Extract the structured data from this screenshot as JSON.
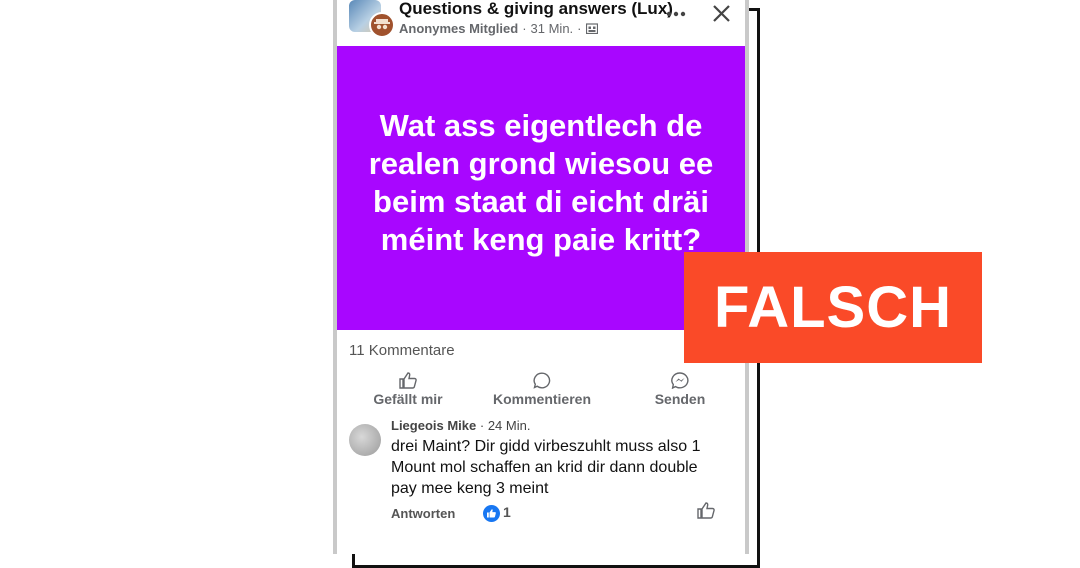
{
  "post": {
    "group_name": "Questions & giving answers (Lux)",
    "author": "Anonymes Mitglied",
    "time": "31 Min.",
    "text": "Wat ass eigentlech de realen grond wiesou ee beim staat di eicht dräi méint keng paie kritt?",
    "background_color": "#a806ff",
    "comment_count": "11 Kommentare"
  },
  "actions": {
    "like_label": "Gefällt mir",
    "comment_label": "Kommentieren",
    "send_label": "Senden"
  },
  "comment": {
    "author": "Liegeois Mike",
    "time": "24 Min.",
    "text": "drei Maint? Dir gidd virbeszuhlt muss also 1 Mount mol schaffen an krid dir dann double pay mee keng 3 meint",
    "reply_label": "Antworten",
    "like_count": "1"
  },
  "verdict": {
    "label": "FALSCH",
    "color": "#fa4a28"
  },
  "icons": {
    "more": "more-horizontal-icon",
    "close": "close-icon",
    "audience": "group-audience-icon",
    "like": "thumbs-up-icon",
    "comment": "comment-bubble-icon",
    "send": "messenger-icon"
  }
}
